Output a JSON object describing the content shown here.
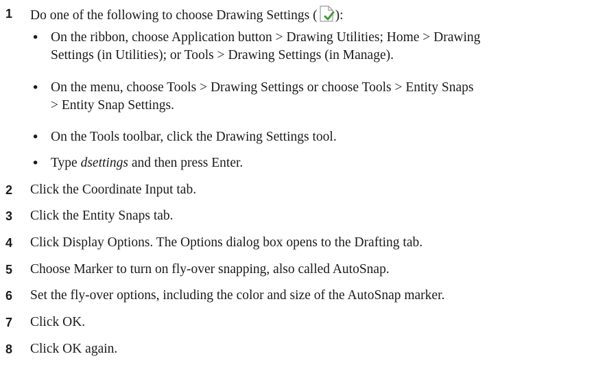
{
  "steps": [
    {
      "number": "1",
      "text_before": "Do one of the following to choose Drawing Settings (",
      "icon": "drawing-settings-icon",
      "text_after": "):",
      "bullets": [
        {
          "line1": "On the ribbon, choose Application button > Drawing Utilities; Home > Drawing",
          "line2": "Settings (in Utilities); or Tools > Drawing Settings (in Manage)."
        },
        {
          "line1": "On the menu, choose Tools > Drawing Settings or choose Tools > Entity Snaps",
          "line2": "> Entity Snap Settings."
        },
        {
          "line1": "On the Tools toolbar, click the Drawing Settings tool."
        },
        {
          "prefix": "Type ",
          "command": "dsettings",
          "suffix": " and then press Enter."
        }
      ]
    },
    {
      "number": "2",
      "text": "Click the Coordinate Input tab."
    },
    {
      "number": "3",
      "text": "Click the Entity Snaps tab."
    },
    {
      "number": "4",
      "text": "Click Display Options. The Options dialog box opens to the Drafting tab."
    },
    {
      "number": "5",
      "text": "Choose Marker to turn on fly-over snapping, also called AutoSnap."
    },
    {
      "number": "6",
      "text": "Set the fly-over options, including the color and size of the AutoSnap marker."
    },
    {
      "number": "7",
      "text": "Click OK."
    },
    {
      "number": "8",
      "text": "Click OK again."
    }
  ],
  "colors": {
    "text": "#1a1a1a",
    "icon_check": "#3a9b3a",
    "icon_outline": "#9a9a9a"
  }
}
